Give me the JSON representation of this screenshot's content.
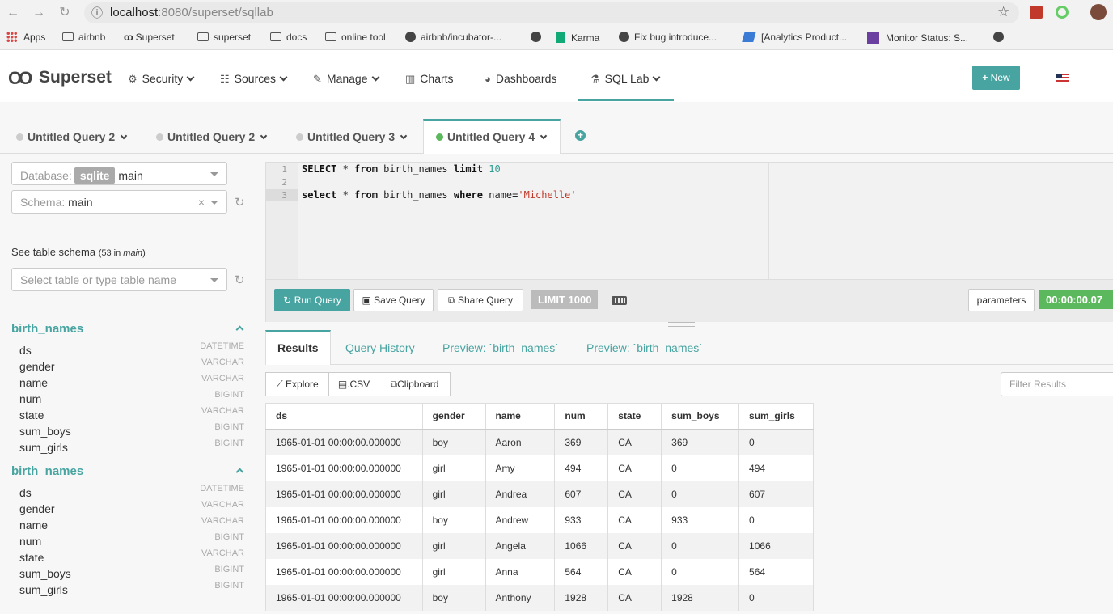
{
  "browser": {
    "url_host": "localhost",
    "url_rest": ":8080/superset/sqllab",
    "bookmarks": [
      "Apps",
      "airbnb",
      "Superset",
      "superset",
      "docs",
      "online tool",
      "airbnb/incubator-...",
      "Karma",
      "Fix bug introduce...",
      "[Analytics Product...",
      "Monitor Status: S..."
    ]
  },
  "nav": {
    "brand": "Superset",
    "items": [
      "Security",
      "Sources",
      "Manage",
      "Charts",
      "Dashboards",
      "SQL Lab"
    ],
    "new_button": "New"
  },
  "query_tabs": [
    {
      "label": "Untitled Query 2",
      "active": false
    },
    {
      "label": "Untitled Query 2",
      "active": false
    },
    {
      "label": "Untitled Query 3",
      "active": false
    },
    {
      "label": "Untitled Query 4",
      "active": true
    }
  ],
  "left_panel": {
    "database_label": "Database:",
    "database_backend": "sqlite",
    "database_value": "main",
    "schema_label": "Schema:",
    "schema_value": "main",
    "schema_title": "See table schema",
    "schema_count_prefix": "(53 in ",
    "schema_count_name": "main",
    "schema_count_suffix": ")",
    "table_placeholder": "Select table or type table name",
    "tables": [
      {
        "name": "birth_names",
        "columns": [
          {
            "name": "ds",
            "type": "DATETIME"
          },
          {
            "name": "gender",
            "type": "VARCHAR"
          },
          {
            "name": "name",
            "type": "VARCHAR"
          },
          {
            "name": "num",
            "type": "BIGINT"
          },
          {
            "name": "state",
            "type": "VARCHAR"
          },
          {
            "name": "sum_boys",
            "type": "BIGINT"
          },
          {
            "name": "sum_girls",
            "type": "BIGINT"
          }
        ]
      },
      {
        "name": "birth_names",
        "columns": [
          {
            "name": "ds",
            "type": "DATETIME"
          },
          {
            "name": "gender",
            "type": "VARCHAR"
          },
          {
            "name": "name",
            "type": "VARCHAR"
          },
          {
            "name": "num",
            "type": "BIGINT"
          },
          {
            "name": "state",
            "type": "VARCHAR"
          },
          {
            "name": "sum_boys",
            "type": "BIGINT"
          },
          {
            "name": "sum_girls",
            "type": "BIGINT"
          }
        ]
      }
    ]
  },
  "editor": {
    "line_numbers": [
      "1",
      "2",
      "3"
    ],
    "line1": {
      "kw1": "SELECT",
      "t1": " * ",
      "kw2": "from",
      "t2": " birth_names ",
      "kw3": "limit",
      "t3": " ",
      "num": "10"
    },
    "line3": {
      "kw1": "select",
      "t1": " * ",
      "kw2": "from",
      "t2": " birth_names ",
      "kw3": "where",
      "t3": " name=",
      "str": "'Michelle'"
    }
  },
  "toolbar": {
    "run": "Run Query",
    "save": "Save Query",
    "share": "Share Query",
    "limit": "LIMIT 1000",
    "parameters": "parameters",
    "timer": "00:00:00.07"
  },
  "result_tabs": [
    "Results",
    "Query History",
    "Preview: `birth_names`",
    "Preview: `birth_names`"
  ],
  "result_actions": {
    "explore": "Explore",
    "csv": ".CSV",
    "clipboard": "Clipboard",
    "filter_placeholder": "Filter Results"
  },
  "results": {
    "columns": [
      "ds",
      "gender",
      "name",
      "num",
      "state",
      "sum_boys",
      "sum_girls"
    ],
    "rows": [
      [
        "1965-01-01 00:00:00.000000",
        "boy",
        "Aaron",
        "369",
        "CA",
        "369",
        "0"
      ],
      [
        "1965-01-01 00:00:00.000000",
        "girl",
        "Amy",
        "494",
        "CA",
        "0",
        "494"
      ],
      [
        "1965-01-01 00:00:00.000000",
        "girl",
        "Andrea",
        "607",
        "CA",
        "0",
        "607"
      ],
      [
        "1965-01-01 00:00:00.000000",
        "boy",
        "Andrew",
        "933",
        "CA",
        "933",
        "0"
      ],
      [
        "1965-01-01 00:00:00.000000",
        "girl",
        "Angela",
        "1066",
        "CA",
        "0",
        "1066"
      ],
      [
        "1965-01-01 00:00:00.000000",
        "girl",
        "Anna",
        "564",
        "CA",
        "0",
        "564"
      ],
      [
        "1965-01-01 00:00:00.000000",
        "boy",
        "Anthony",
        "1928",
        "CA",
        "1928",
        "0"
      ]
    ]
  }
}
